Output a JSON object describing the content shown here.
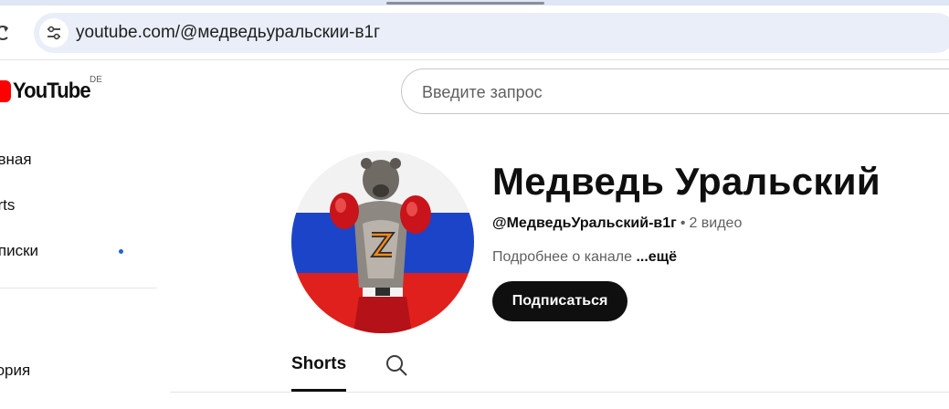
{
  "browser": {
    "url": "youtube.com/@медведьуральскии-в1г"
  },
  "masthead": {
    "logo_text": "YouTube",
    "region": "DE",
    "search_placeholder": "Введите запрос"
  },
  "sidebar": {
    "items": [
      {
        "label": "авная"
      },
      {
        "label": "orts"
      },
      {
        "label": "дписки"
      },
      {
        "label": "тория"
      }
    ]
  },
  "channel": {
    "name": "Медведь Уральский",
    "handle": "@МедведьУральский-в1г",
    "separator": "•",
    "video_count": "2 видео",
    "about": "Подробнее о канале",
    "more": "...ещё",
    "subscribe": "Подписаться"
  },
  "tabs": [
    {
      "label": "Shorts",
      "selected": true
    }
  ],
  "colors": {
    "brand_red": "#ff0000",
    "subscribe_bg": "#0f0f0f",
    "notification_dot": "#1e65d6"
  },
  "icons": {
    "reload": "reload-icon",
    "site_info": "site-info-icon",
    "tab_search": "search-icon"
  }
}
